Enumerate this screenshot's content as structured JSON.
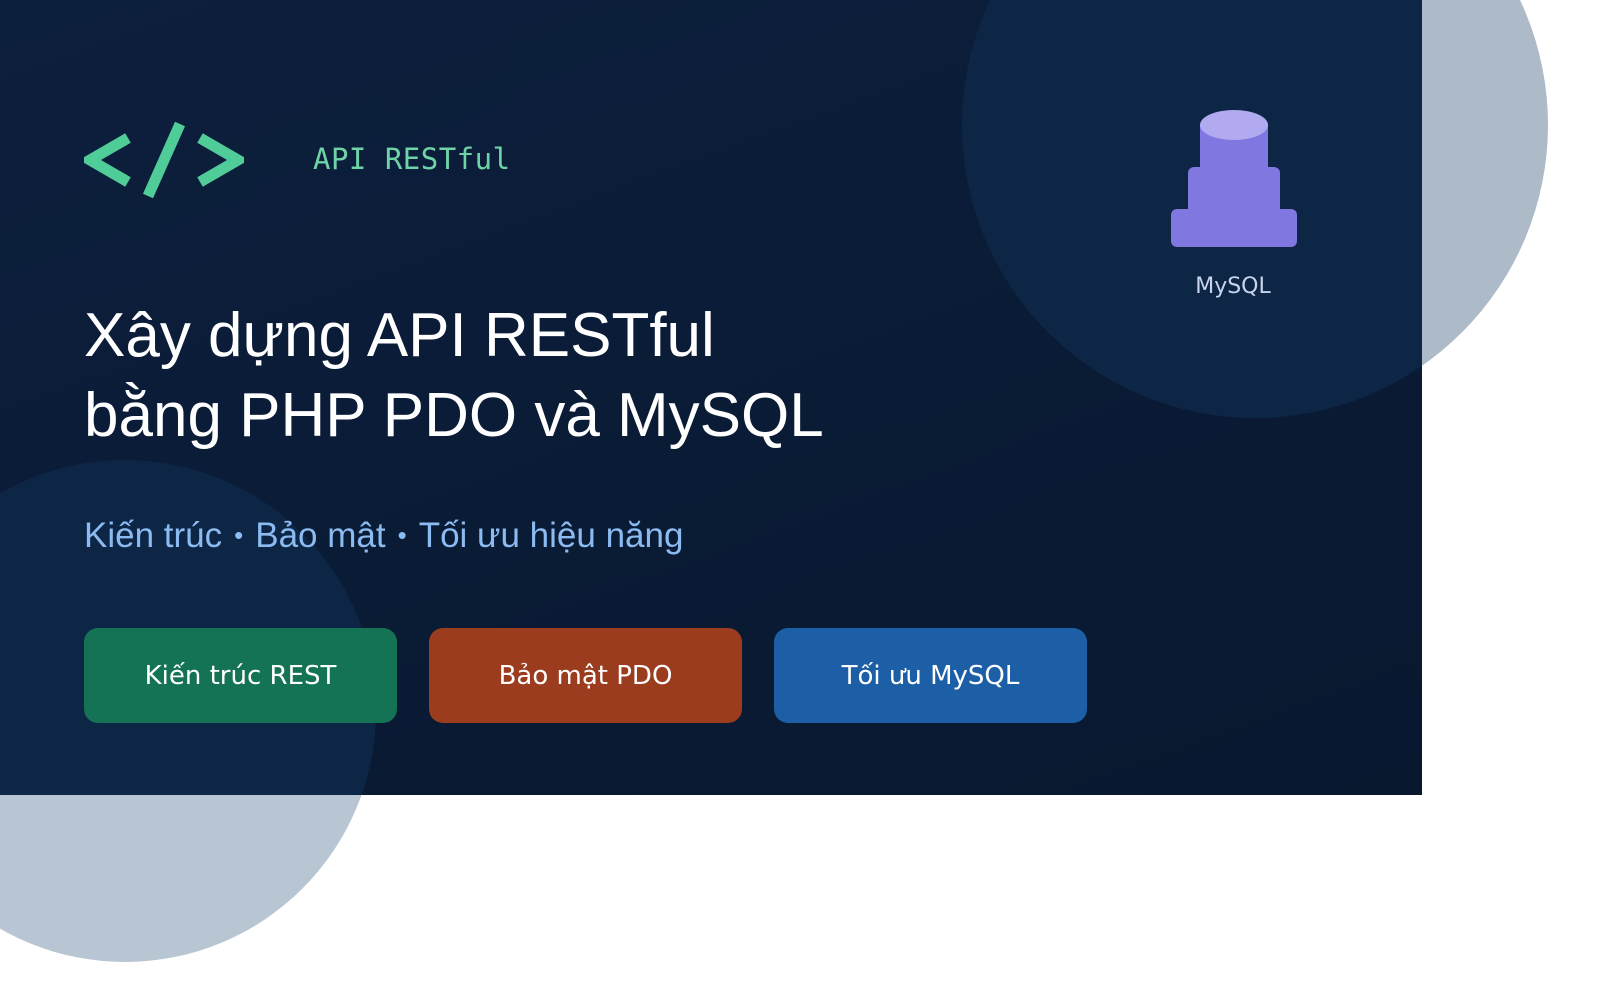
{
  "banner": {
    "tag_label": "API RESTful",
    "db_label": "MySQL",
    "title_line1": "Xây dựng API RESTful",
    "title_line2": "bằng PHP PDO và MySQL",
    "subtitle": {
      "items": [
        "Kiến trúc",
        "Bảo mật",
        "Tối ưu hiệu năng"
      ],
      "separator": "•"
    },
    "buttons": [
      {
        "label": "Kiến trúc REST",
        "color": "#137354"
      },
      {
        "label": "Bảo mật PDO",
        "color": "#9b3c1f"
      },
      {
        "label": "Tối ưu MySQL",
        "color": "#1c5fa6"
      }
    ]
  },
  "colors": {
    "background_dark": "#0b1e3a",
    "accent_green": "#4fcc98",
    "db_purple": "#8077e0",
    "subtitle_blue": "#8cbbf1"
  },
  "icons": {
    "code": "code-brackets-icon",
    "database": "database-icon"
  }
}
